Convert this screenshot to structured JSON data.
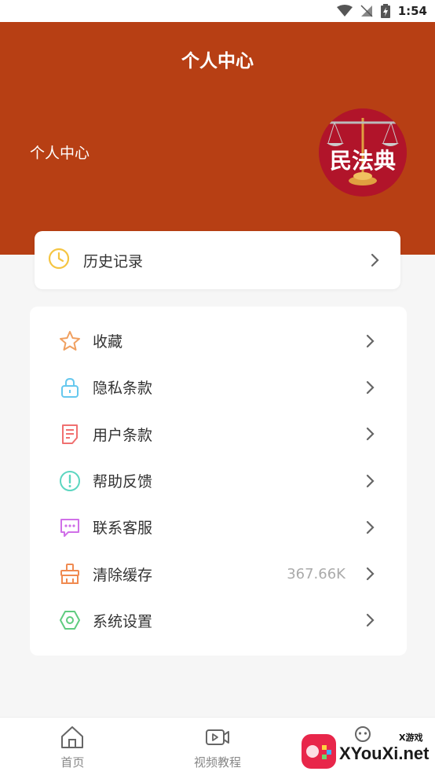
{
  "status_bar": {
    "time": "1:54"
  },
  "header": {
    "title": "个人中心",
    "username": "个人中心",
    "avatar_text": "民法典"
  },
  "history": {
    "label": "历史记录",
    "icon": "clock-icon"
  },
  "menu": [
    {
      "label": "收藏",
      "icon": "star-icon",
      "value": "",
      "color": "#f0a060"
    },
    {
      "label": "隐私条款",
      "icon": "lock-icon",
      "value": "",
      "color": "#66c8ee"
    },
    {
      "label": "用户条款",
      "icon": "document-icon",
      "value": "",
      "color": "#f07070"
    },
    {
      "label": "帮助反馈",
      "icon": "exclamation-icon",
      "value": "",
      "color": "#5cd6c0"
    },
    {
      "label": "联系客服",
      "icon": "chat-icon",
      "value": "",
      "color": "#d070e8"
    },
    {
      "label": "清除缓存",
      "icon": "broom-icon",
      "value": "367.66K",
      "color": "#f08a50"
    },
    {
      "label": "系统设置",
      "icon": "gear-hex-icon",
      "value": "",
      "color": "#60cc80"
    }
  ],
  "tabs": [
    {
      "label": "首页",
      "icon": "home-icon"
    },
    {
      "label": "视频教程",
      "icon": "video-icon"
    },
    {
      "label": "",
      "icon": "user-icon"
    }
  ],
  "watermark": {
    "text": "XYouXi.net",
    "small": "X游戏"
  },
  "colors": {
    "header_bg": "#b73f14",
    "page_bg": "#f6f6f6"
  }
}
